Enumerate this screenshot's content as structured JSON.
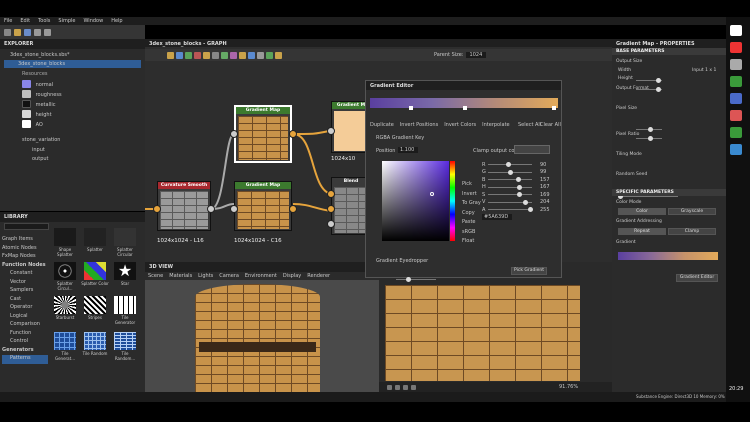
{
  "menu": [
    "File",
    "Edit",
    "Tools",
    "Simple",
    "Window",
    "Help"
  ],
  "explorer": {
    "title": "EXPLORER",
    "file": "3dex_stone_blocks.sbs*",
    "graph": "3dex_stone_blocks",
    "resources_label": "Resources",
    "items": [
      "normal",
      "roughness",
      "metallic",
      "height",
      "AO"
    ],
    "variation": "stone_variation",
    "io": [
      "input",
      "output"
    ]
  },
  "library": {
    "title": "LIBRARY",
    "search_placeholder": "Search",
    "categories": [
      "Graph Items",
      "Atomic Nodes",
      "FxMap Nodes",
      "Function Nodes",
      "Constant",
      "Vector",
      "Samplers",
      "Cast",
      "Operator",
      "Logical",
      "Comparison",
      "Function",
      "Control",
      "Generators",
      "Patterns"
    ],
    "thumbs": [
      [
        "Shape Splatter",
        "Splatter",
        "Splatter Circular"
      ],
      [
        "Splatter Circul...",
        "Splatter Color",
        "Star"
      ],
      [
        "Starburst",
        "Stripes",
        "Tile Generator"
      ],
      [
        "Tile Generat...",
        "Tile Random",
        "Tile Random..."
      ]
    ]
  },
  "graph": {
    "title": "3dex_stone_blocks - GRAPH",
    "parent_size": "Parent Size:",
    "parent_size_value": "1024",
    "nodes": {
      "curvature": "Curvature Smooth",
      "curvature_res": "1024x1024 - L16",
      "gmap1": "Gradient Map",
      "gmap1_res": "1024x1024 - C16",
      "gmap2": "Gradient M",
      "gmap2_res": "1024x10",
      "gmap3": "Gradient Map",
      "blend": "Blend"
    }
  },
  "gradient_editor": {
    "title": "Gradient Editor",
    "toolbar": [
      "Duplicate",
      "Invert Positions",
      "Invert Colors",
      "Interpolate"
    ],
    "select_all": "Select All",
    "clear_all": "Clear All",
    "key_label": "RGBA Gradient Key",
    "position_label": "Position",
    "position_value": "1.100",
    "clamp_label": "Clamp output color",
    "channels": [
      {
        "name": "R",
        "value": "90"
      },
      {
        "name": "G",
        "value": "99"
      },
      {
        "name": "B",
        "value": "157"
      },
      {
        "name": "H",
        "value": "167"
      },
      {
        "name": "S",
        "value": "169"
      },
      {
        "name": "V",
        "value": "204"
      },
      {
        "name": "A",
        "value": "255"
      }
    ],
    "modes": [
      "Pick",
      "Invert",
      "To Gray",
      "Copy",
      "Paste",
      "sRGB",
      "Float"
    ],
    "hex": "#5A639D",
    "eyedropper_label": "Gradient Eyedropper",
    "pick_button": "Pick Gradient"
  },
  "view3d": {
    "title": "3D VIEW",
    "menu": [
      "Scene",
      "Materials",
      "Lights",
      "Camera",
      "Environment",
      "Display",
      "Renderer"
    ]
  },
  "view2d": {
    "zoom": "91.76%",
    "status": "Substance Engine: Direct3D 10   Memory: 0%"
  },
  "properties": {
    "title": "Gradient Map - PROPERTIES",
    "base_params": "BASE PARAMETERS",
    "output_size": "Output Size",
    "width_label": "Width",
    "height_label": "Height",
    "size_value": "Input 1 x 1",
    "output_format": "Output Format",
    "pixel_size": "Pixel Size",
    "pixel_ratio": "Pixel Ratio",
    "tiling_mode": "Tiling Mode",
    "random_seed": "Random Seed",
    "specific_params": "SPECIFIC PARAMETERS",
    "color_mode": "Color Mode",
    "color_btn": "Color",
    "grayscale_btn": "Grayscale",
    "gradient_addressing": "Gradient Addressing",
    "repeat_btn": "Repeat",
    "clamp_btn": "Clamp",
    "gradient_label": "Gradient",
    "gradient_editor_btn": "Gradient Editor"
  },
  "taskbar": {
    "time": "20:29"
  },
  "colors": {
    "accent": "#e6a43c",
    "gradient_start": "#5a3fa0",
    "gradient_end": "#e2aa5a"
  }
}
